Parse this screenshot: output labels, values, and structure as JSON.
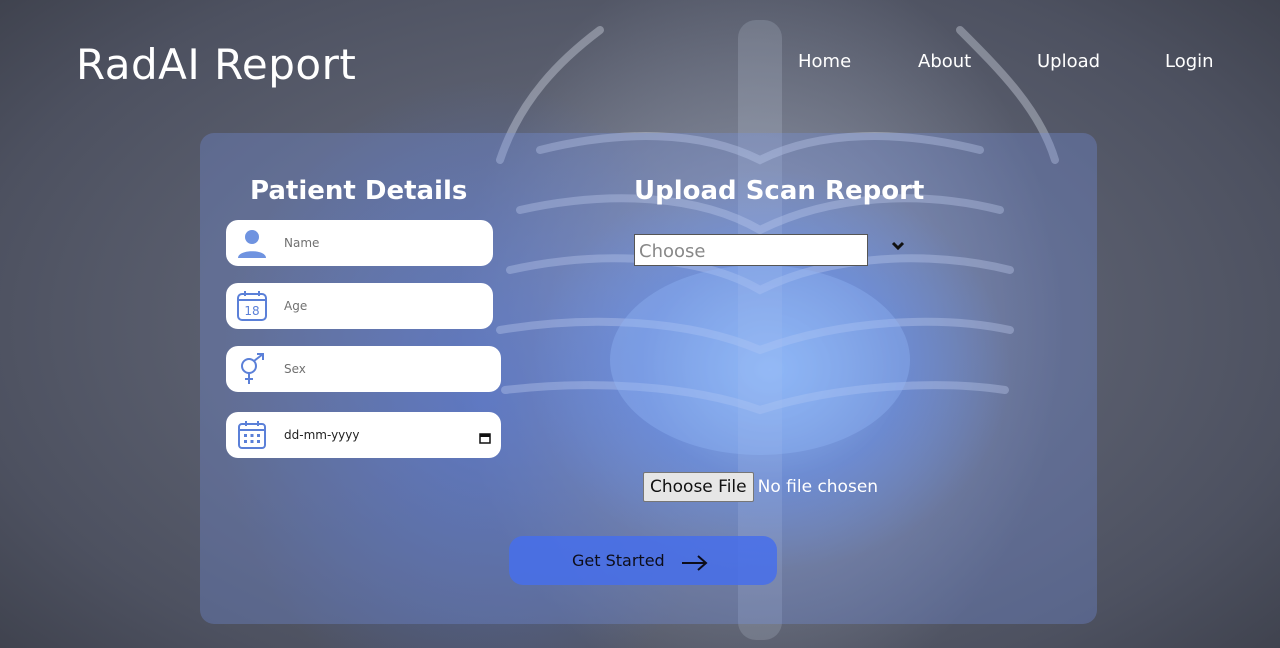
{
  "brand": {
    "title": "RadAI Report"
  },
  "nav": {
    "items": [
      {
        "label": "Home"
      },
      {
        "label": "About"
      },
      {
        "label": "Upload"
      },
      {
        "label": "Login"
      }
    ]
  },
  "patient": {
    "heading": "Patient Details",
    "name_placeholder": "Name",
    "age_placeholder": "Age",
    "age_icon_number": "18",
    "sex_placeholder": "Sex",
    "date_value": "dd-mm-yyyy"
  },
  "scan": {
    "heading": "Upload Scan Report",
    "select_value": "Choose",
    "file_button": "Choose File",
    "file_status": "No file chosen"
  },
  "cta": {
    "label": "Get Started"
  },
  "colors": {
    "icon_blue": "#5b80d8",
    "panel": "#7896eb",
    "cta": "#466eeb"
  }
}
